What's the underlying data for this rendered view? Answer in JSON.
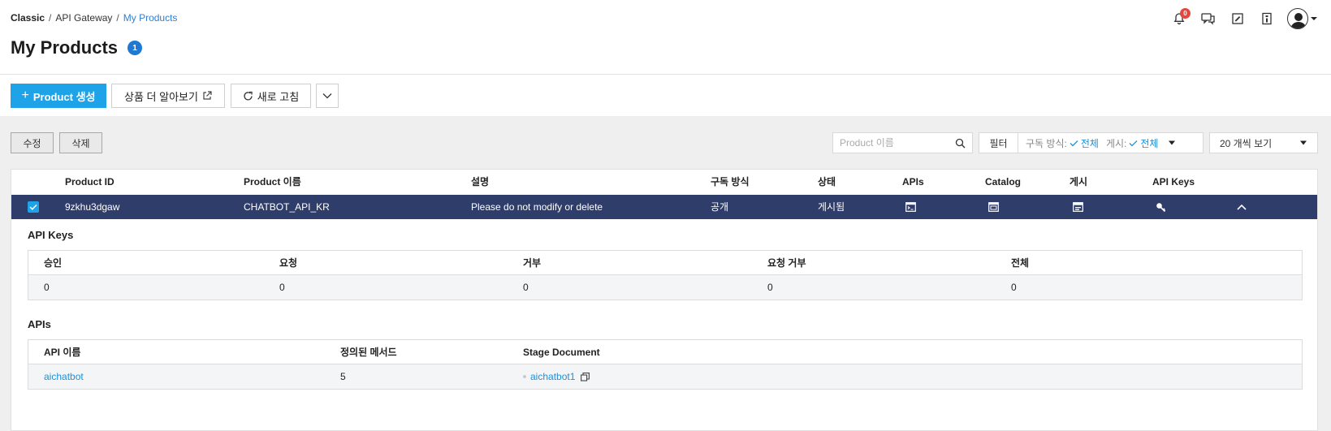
{
  "breadcrumb": {
    "items": [
      "Classic",
      "API Gateway"
    ],
    "current": "My Products",
    "sep": "/"
  },
  "page": {
    "title": "My Products",
    "count": "1"
  },
  "header": {
    "notification_count": "0",
    "icons": [
      "bell-icon",
      "chat-icon",
      "edit-note-icon",
      "document-icon",
      "user-avatar-icon"
    ]
  },
  "toolbar": {
    "create_label": "Product 생성",
    "learn_more_label": "상품 더 알아보기",
    "refresh_label": "새로 고침"
  },
  "actions": {
    "edit_label": "수정",
    "delete_label": "삭제"
  },
  "search": {
    "placeholder": "Product 이름"
  },
  "filter": {
    "button_label": "필터",
    "subscription_label": "구독 방식:",
    "subscription_value": "전체",
    "publish_label": "게시:",
    "publish_value": "전체"
  },
  "page_size": {
    "selected": "20 개씩 보기"
  },
  "table": {
    "columns": [
      "Product ID",
      "Product 이름",
      "설명",
      "구독 방식",
      "상태",
      "APIs",
      "Catalog",
      "게시",
      "API Keys"
    ],
    "row": {
      "id": "9zkhu3dgaw",
      "name": "CHATBOT_API_KR",
      "description": "Please do not modify or delete",
      "subscription": "공개",
      "status": "게시됨"
    }
  },
  "api_keys": {
    "title": "API Keys",
    "columns": [
      "승인",
      "요청",
      "거부",
      "요청 거부",
      "전체"
    ],
    "values": [
      "0",
      "0",
      "0",
      "0",
      "0"
    ]
  },
  "apis": {
    "title": "APIs",
    "columns": [
      "API 이름",
      "정의된 메서드",
      "Stage Document"
    ],
    "row": {
      "name": "aichatbot",
      "methods": "5",
      "stage_doc": "aichatbot1"
    }
  },
  "colors": {
    "primary": "#1fa3e8",
    "selected_row": "#2f3d6b",
    "link": "#1f90d6",
    "badge": "#1f78d1",
    "notification": "#e8453c"
  }
}
